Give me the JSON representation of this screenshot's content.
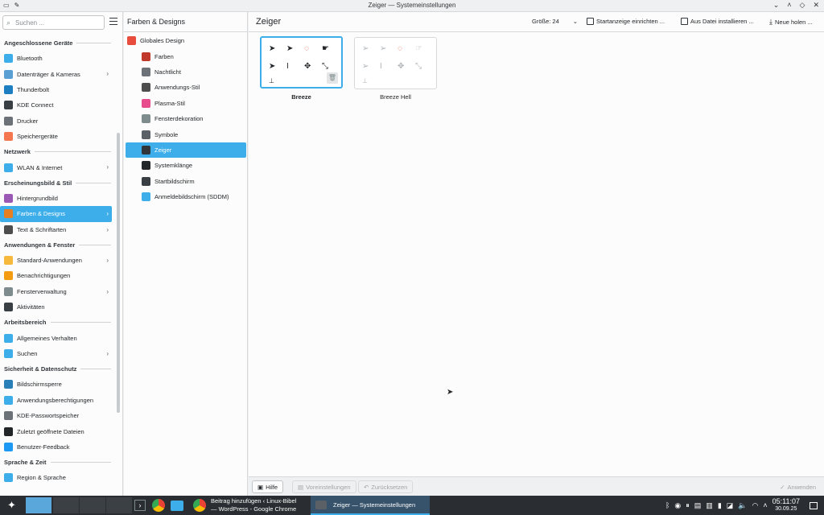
{
  "window": {
    "title": "Zeiger — Systemeinstellungen",
    "controls": [
      "⌄",
      "˄",
      "◇",
      "✕"
    ]
  },
  "search": {
    "placeholder": "Suchen ..."
  },
  "sidebar": [
    {
      "type": "section",
      "label": "Angeschlossene Geräte"
    },
    {
      "type": "item",
      "label": "Bluetooth",
      "icon": "bluetooth-icon",
      "color": "#3daee9",
      "chevron": false
    },
    {
      "type": "item",
      "label": "Datenträger & Kameras",
      "icon": "drive-icon",
      "color": "#5a9fd4",
      "chevron": true
    },
    {
      "type": "item",
      "label": "Thunderbolt",
      "icon": "thunderbolt-icon",
      "color": "#1d7fc1",
      "chevron": false
    },
    {
      "type": "item",
      "label": "KDE Connect",
      "icon": "kdeconnect-icon",
      "color": "#3a3f44",
      "chevron": false
    },
    {
      "type": "item",
      "label": "Drucker",
      "icon": "printer-icon",
      "color": "#6c7278",
      "chevron": false
    },
    {
      "type": "item",
      "label": "Speichergeräte",
      "icon": "storage-icon",
      "color": "#f47750",
      "chevron": false
    },
    {
      "type": "section",
      "label": "Netzwerk"
    },
    {
      "type": "item",
      "label": "WLAN & Internet",
      "icon": "network-icon",
      "color": "#3daee9",
      "chevron": true
    },
    {
      "type": "section",
      "label": "Erscheinungsbild & Stil"
    },
    {
      "type": "item",
      "label": "Hintergrundbild",
      "icon": "wallpaper-icon",
      "color": "#9b59b6",
      "chevron": false
    },
    {
      "type": "item",
      "label": "Farben & Designs",
      "icon": "colors-icon",
      "color": "#e67e22",
      "chevron": true,
      "active": true
    },
    {
      "type": "item",
      "label": "Text & Schriftarten",
      "icon": "font-icon",
      "color": "#4d4d4d",
      "chevron": true
    },
    {
      "type": "section",
      "label": "Anwendungen & Fenster"
    },
    {
      "type": "item",
      "label": "Standard-Anwendungen",
      "icon": "star-icon",
      "color": "#f6b93b",
      "chevron": true
    },
    {
      "type": "item",
      "label": "Benachrichtigungen",
      "icon": "bell-icon",
      "color": "#f39c12",
      "chevron": false
    },
    {
      "type": "item",
      "label": "Fensterverwaltung",
      "icon": "window-icon",
      "color": "#7f8c8d",
      "chevron": true
    },
    {
      "type": "item",
      "label": "Aktivitäten",
      "icon": "activities-icon",
      "color": "#3a3f44",
      "chevron": false
    },
    {
      "type": "section",
      "label": "Arbeitsbereich"
    },
    {
      "type": "item",
      "label": "Allgemeines Verhalten",
      "icon": "behavior-icon",
      "color": "#3daee9",
      "chevron": false
    },
    {
      "type": "item",
      "label": "Suchen",
      "icon": "search-icon",
      "color": "#3daee9",
      "chevron": true
    },
    {
      "type": "section",
      "label": "Sicherheit & Datenschutz"
    },
    {
      "type": "item",
      "label": "Bildschirmsperre",
      "icon": "lock-screen-icon",
      "color": "#2980b9",
      "chevron": false
    },
    {
      "type": "item",
      "label": "Anwendungsberechtigungen",
      "icon": "shield-icon",
      "color": "#3daee9",
      "chevron": false
    },
    {
      "type": "item",
      "label": "KDE-Passwortspeicher",
      "icon": "key-icon",
      "color": "#6c7278",
      "chevron": false
    },
    {
      "type": "item",
      "label": "Zuletzt geöffnete Dateien",
      "icon": "history-icon",
      "color": "#232629",
      "chevron": false
    },
    {
      "type": "item",
      "label": "Benutzer-Feedback",
      "icon": "feedback-icon",
      "color": "#1d99f3",
      "chevron": false
    },
    {
      "type": "section",
      "label": "Sprache & Zeit"
    },
    {
      "type": "item",
      "label": "Region & Sprache",
      "icon": "flag-icon",
      "color": "#3daee9",
      "chevron": false
    }
  ],
  "mid": {
    "header": "Farben & Designs",
    "items": [
      {
        "label": "Globales Design",
        "icon": "global-theme-icon",
        "color": "#e74c3c",
        "top": true
      },
      {
        "label": "Farben",
        "icon": "colors-icon",
        "color": "#c0392b"
      },
      {
        "label": "Nachtlicht",
        "icon": "night-light-icon",
        "color": "#6c7278"
      },
      {
        "label": "Anwendungs-Stil",
        "icon": "app-style-icon",
        "color": "#4d4d4d"
      },
      {
        "label": "Plasma-Stil",
        "icon": "plasma-style-icon",
        "color": "#e74c8c"
      },
      {
        "label": "Fensterdekoration",
        "icon": "window-decoration-icon",
        "color": "#7f8c8d"
      },
      {
        "label": "Symbole",
        "icon": "icons-icon",
        "color": "#5a6066"
      },
      {
        "label": "Zeiger",
        "icon": "cursor-icon",
        "color": "#31363b",
        "active": true
      },
      {
        "label": "Systemklänge",
        "icon": "sound-icon",
        "color": "#232629"
      },
      {
        "label": "Startbildschirm",
        "icon": "splash-icon",
        "color": "#3a3f44"
      },
      {
        "label": "Anmeldebildschirm (SDDM)",
        "icon": "login-screen-icon",
        "color": "#3daee9"
      }
    ]
  },
  "main": {
    "page_title": "Zeiger",
    "size_label": "Größe: 24",
    "startup_label": "Startanzeige einrichten ...",
    "install_label": "Aus Datei installieren ...",
    "get_new_label": "Neue holen ...",
    "themes": [
      {
        "name": "Breeze",
        "selected": true,
        "dark": true
      },
      {
        "name": "Breeze Hell",
        "selected": false,
        "dark": false
      }
    ]
  },
  "bottom": {
    "help": "Hilfe",
    "defaults": "Voreinstellungen",
    "reset": "Zurücksetzen",
    "apply": "Anwenden"
  },
  "taskbar": {
    "tasks": [
      {
        "label": "Beitrag hinzufügen ‹ Linux-Bibel\n— WordPress - Google Chrome",
        "icon": "chrome-icon"
      },
      {
        "label": "Zeiger — Systemeinstellungen",
        "icon": "settings-icon",
        "active": true
      }
    ],
    "time": "05:11:07",
    "date": "30.09.25"
  }
}
